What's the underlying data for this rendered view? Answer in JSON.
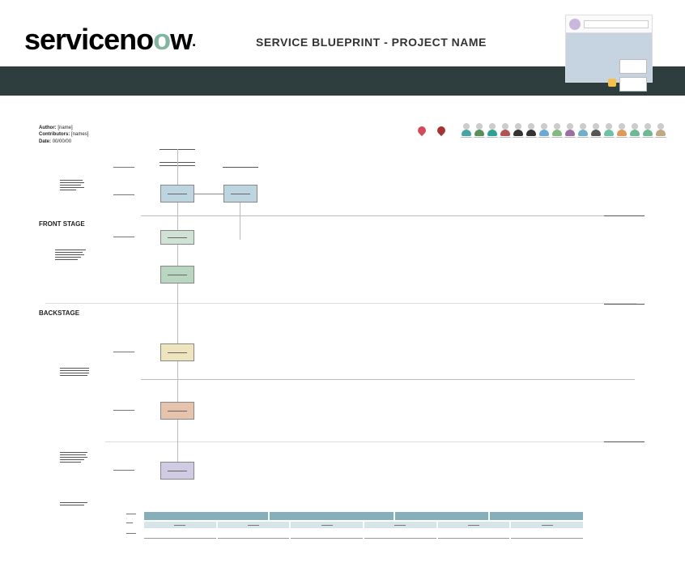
{
  "header": {
    "logo_text_pre": "serviceno",
    "logo_text_g": "o",
    "logo_text_post": "w",
    "title": "SERVICE BLUEPRINT - PROJECT NAME"
  },
  "meta": {
    "author_label": "Author:",
    "author_value": "[name]",
    "contrib_label": "Contributors:",
    "contrib_value": "[names]",
    "date_label": "Date:",
    "date_value": "00/00/00"
  },
  "zones": {
    "front": "FRONT STAGE",
    "back": "BACKSTAGE"
  },
  "avatars": [
    {
      "body": "#4aa3a3"
    },
    {
      "body": "#5a8f5a"
    },
    {
      "body": "#2f9f8f"
    },
    {
      "body": "#b05454"
    },
    {
      "body": "#333333"
    },
    {
      "body": "#333333"
    },
    {
      "body": "#6aa9d4"
    },
    {
      "body": "#82b882"
    },
    {
      "body": "#9a6ea0"
    },
    {
      "body": "#6fb0c8"
    },
    {
      "body": "#555555"
    },
    {
      "body": "#6fc0a8"
    },
    {
      "body": "#d99a5a"
    },
    {
      "body": "#6fb894"
    },
    {
      "body": "#6fb894"
    },
    {
      "body": "#bfa883"
    }
  ],
  "boxes": {
    "a": "",
    "b": "",
    "c": "",
    "d": "",
    "e": "",
    "f": "",
    "g": ""
  },
  "table": {
    "headers": [
      "",
      "",
      "",
      ""
    ],
    "rows": [
      [
        "",
        "",
        "",
        "",
        "",
        ""
      ]
    ]
  }
}
